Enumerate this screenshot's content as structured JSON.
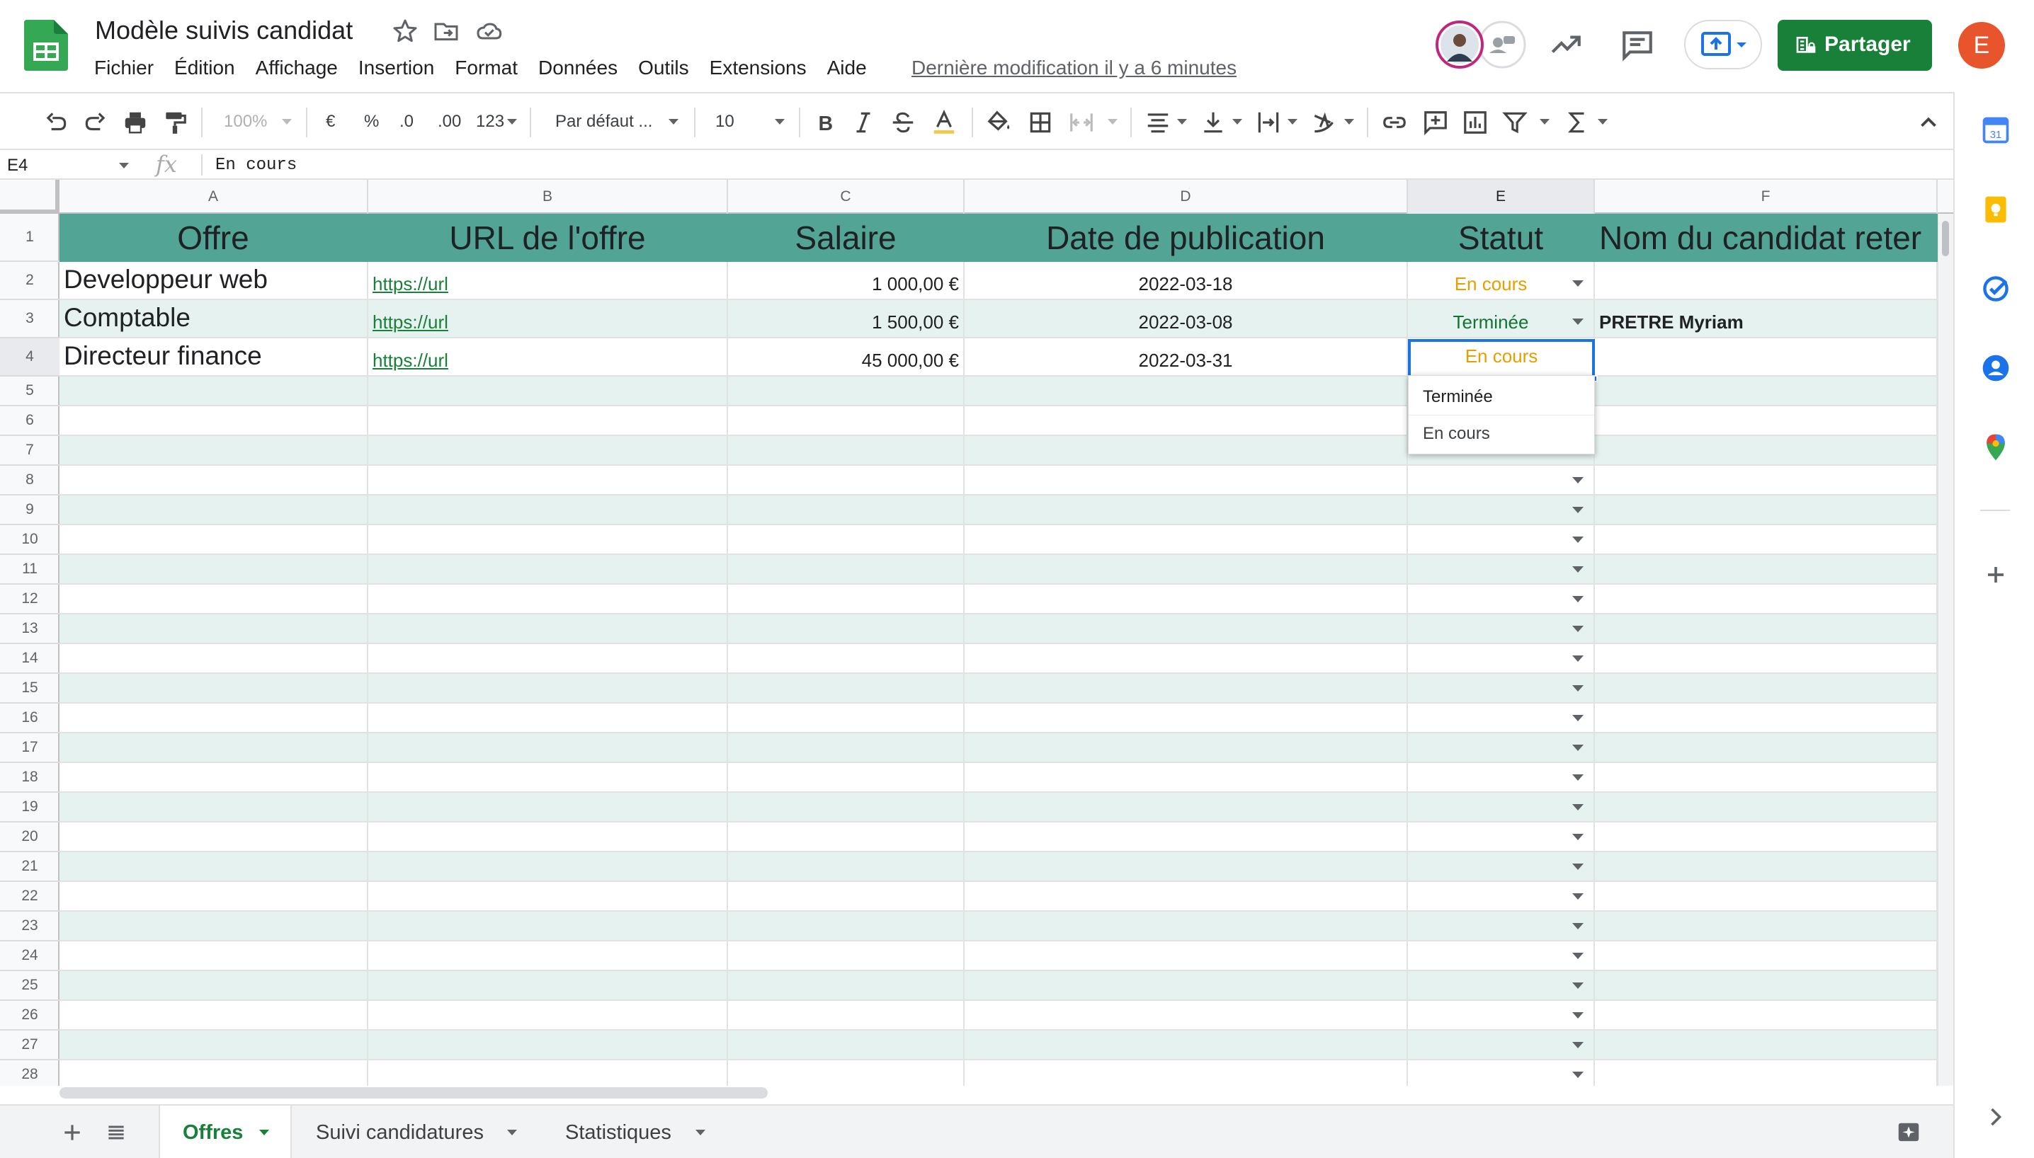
{
  "app": {
    "title": "Modèle suivis candidat",
    "last_edit": "Dernière modification il y a 6 minutes",
    "share_label": "Partager",
    "user_initial": "E",
    "colors": {
      "share": "#188038",
      "header_row": "#52a495",
      "band": "#e6f2ef",
      "status_en_cours": "#e5a000",
      "status_terminee": "#137333",
      "avatar": "#e8542c"
    }
  },
  "menu": [
    "Fichier",
    "Édition",
    "Affichage",
    "Insertion",
    "Format",
    "Données",
    "Outils",
    "Extensions",
    "Aide"
  ],
  "toolbar": {
    "zoom": "100%",
    "currency": "€",
    "percent": "%",
    "dec_less": ".0",
    "dec_more": ".00",
    "more_formats": "123",
    "font": "Par défaut ...",
    "font_size": "10"
  },
  "formula_bar": {
    "cell_ref": "E4",
    "fx": "fx",
    "content": "En cours"
  },
  "columns": [
    "A",
    "B",
    "C",
    "D",
    "E",
    "F"
  ],
  "rows": [
    "1",
    "2",
    "3",
    "4",
    "5",
    "6",
    "7",
    "8",
    "9",
    "10",
    "11",
    "12",
    "13",
    "14",
    "15",
    "16",
    "17",
    "18",
    "19",
    "20",
    "21",
    "22",
    "23",
    "24",
    "25",
    "26",
    "27",
    "28"
  ],
  "sheet": {
    "headers": [
      "Offre",
      "URL de l'offre",
      "Salaire",
      "Date de publication",
      "Statut",
      "Nom du candidat reter"
    ],
    "data": [
      [
        "Developpeur web",
        "https://url",
        "1 000,00 €",
        "2022-03-18",
        "En cours",
        ""
      ],
      [
        "Comptable",
        "https://url",
        "1 500,00 €",
        "2022-03-08",
        "Terminée",
        "PRETRE Myriam"
      ],
      [
        "Directeur finance",
        "https://url",
        "45 000,00 €",
        "2022-03-31",
        "En cours",
        ""
      ]
    ]
  },
  "dropdown": {
    "options": [
      "Terminée",
      "En cours"
    ]
  },
  "tabs": [
    "Offres",
    "Suivi candidatures",
    "Statistiques"
  ]
}
